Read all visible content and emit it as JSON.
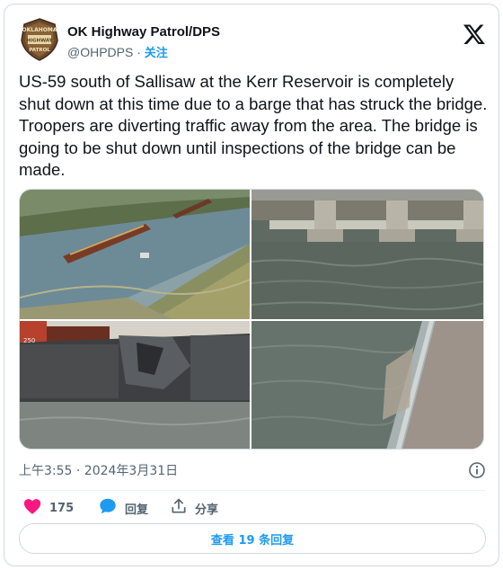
{
  "author": {
    "name": "OK Highway Patrol/DPS",
    "handle": "@OHPDPS",
    "separator": "·",
    "follow_label": "关注",
    "avatar_badge_text": [
      "OKLAHOMA",
      "HIGHWAY",
      "PATROL"
    ],
    "avatar_icon": "ohp-badge-icon"
  },
  "platform_icon": "x-logo-icon",
  "tweet": {
    "text": "US-59 south of Sallisaw at the Kerr Reservoir is completely shut down at this time due to a barge that has struck the bridge. Troopers are diverting traffic away from the area. The bridge is going to be shut down until inspections of the bridge can be made."
  },
  "media": {
    "photos": [
      {
        "subject": "aerial-barge-on-reservoir"
      },
      {
        "subject": "bridge-pillars-over-water"
      },
      {
        "subject": "damaged-barge-hull"
      },
      {
        "subject": "bridge-support-wall-at-waterline"
      }
    ]
  },
  "timestamp": {
    "text": "上午3:55 · 2024年3月31日",
    "info_icon": "info-icon"
  },
  "actions": {
    "like": {
      "count": "175",
      "icon": "heart-icon",
      "color": "#f91880"
    },
    "reply": {
      "label": "回复",
      "icon": "reply-bubble-icon",
      "color": "#1d9bf0"
    },
    "share": {
      "label": "分享",
      "icon": "share-icon"
    }
  },
  "view_replies": {
    "label": "查看 19 条回复"
  },
  "colors": {
    "accent": "#1d9bf0",
    "text_primary": "#0f1419",
    "text_secondary": "#536471",
    "border": "#cfd9de"
  }
}
